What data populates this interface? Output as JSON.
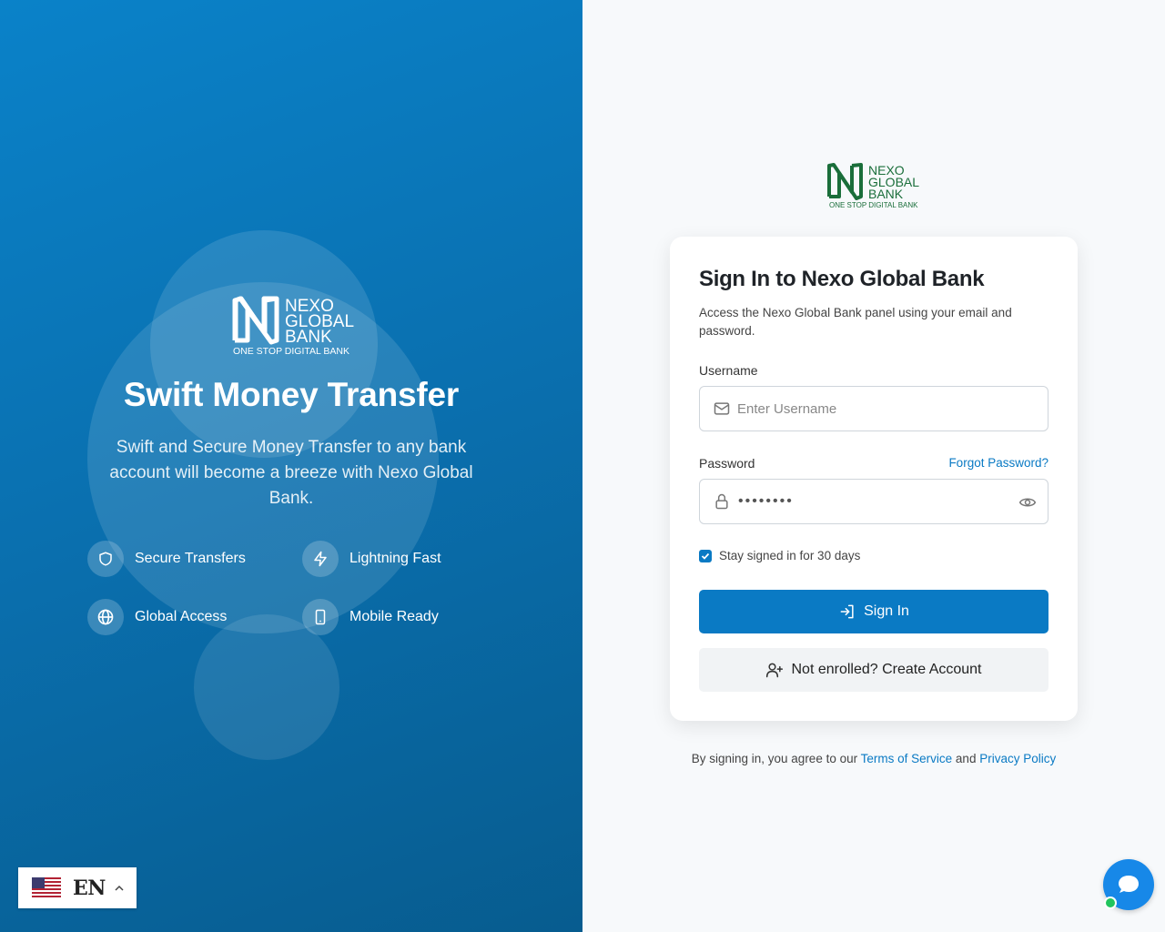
{
  "brand": {
    "logo_name_line1": "NEXO",
    "logo_name_line2": "GLOBAL",
    "logo_name_line3": "BANK",
    "logo_tagline": "ONE STOP DIGITAL BANK",
    "primary_color": "#0a7ac4",
    "logo_green": "#1a6e3a"
  },
  "hero": {
    "title": "Swift Money Transfer",
    "subtitle": "Swift and Secure Money Transfer to any bank account will become a breeze with Nexo Global Bank.",
    "features": [
      {
        "label": "Secure Transfers",
        "icon": "shield-icon"
      },
      {
        "label": "Lightning Fast",
        "icon": "lightning-icon"
      },
      {
        "label": "Global Access",
        "icon": "globe-icon"
      },
      {
        "label": "Mobile Ready",
        "icon": "smartphone-icon"
      }
    ]
  },
  "language": {
    "code": "EN",
    "flag": "us-flag-icon"
  },
  "signin": {
    "title": "Sign In to Nexo Global Bank",
    "description": "Access the Nexo Global Bank panel using your email and password.",
    "username_label": "Username",
    "username_placeholder": "Enter Username",
    "username_value": "",
    "password_label": "Password",
    "password_masked": "••••••••",
    "forgot_label": "Forgot Password?",
    "remember_label": "Stay signed in for 30 days",
    "remember_checked": true,
    "signin_button": "Sign In",
    "create_button": "Not enrolled? Create Account"
  },
  "terms": {
    "prefix": "By signing in, you agree to our",
    "tos": "Terms of Service",
    "and": "and",
    "privacy": "Privacy Policy"
  }
}
